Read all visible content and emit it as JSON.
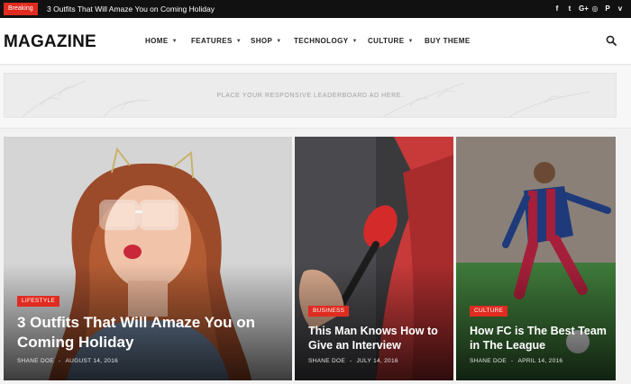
{
  "topbar": {
    "badge": "Breaking",
    "headline": "3 Outfits That Will Amaze You on Coming Holiday",
    "social_icons": [
      "facebook-icon",
      "twitter-icon",
      "google-plus-icon",
      "instagram-icon",
      "pinterest-icon",
      "vimeo-icon"
    ],
    "social_glyphs": [
      "f",
      "t",
      "G+",
      "◎",
      "P",
      "v"
    ]
  },
  "header": {
    "logo": "MAGAZINE",
    "nav": [
      {
        "label": "HOME",
        "dropdown": true
      },
      {
        "label": "FEATURES",
        "dropdown": true
      },
      {
        "label": "SHOP",
        "dropdown": true
      },
      {
        "label": "TECHNOLOGY",
        "dropdown": true
      },
      {
        "label": "CULTURE",
        "dropdown": true
      },
      {
        "label": "BUY THEME",
        "dropdown": false
      }
    ]
  },
  "ad": {
    "text": "PLACE YOUR RESPONSIVE LEADERBOARD AD HERE."
  },
  "cards": [
    {
      "category": "LIFESTYLE",
      "title": "3 Outfits That Will Amaze You on Coming Holiday",
      "author": "SHANE DOE",
      "date": "AUGUST 14, 2016"
    },
    {
      "category": "BUSINESS",
      "title": "This Man Knows How to Give an Interview",
      "author": "SHANE DOE",
      "date": "JULY 14, 2016"
    },
    {
      "category": "CULTURE",
      "title": "How FC is The Best Team in The League",
      "author": "SHANE DOE",
      "date": "APRIL 14, 2016"
    }
  ],
  "colors": {
    "accent": "#e02b20",
    "topbar": "#111111"
  }
}
